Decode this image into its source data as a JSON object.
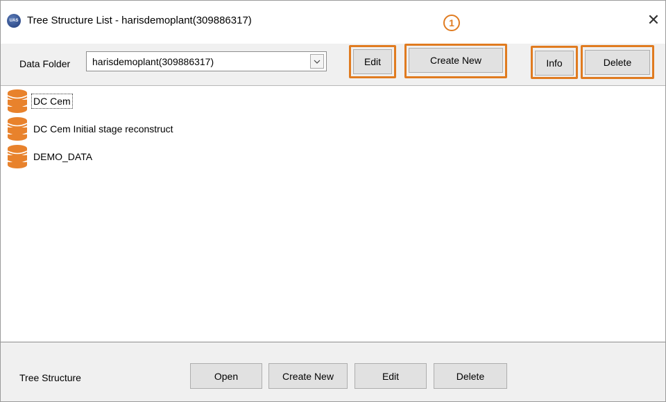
{
  "window": {
    "title": "Tree Structure List - harisdemoplant(309886317)",
    "logo_text": "UAS",
    "close_glyph": "✕"
  },
  "annotation": {
    "step": "1",
    "color": "#e07b20"
  },
  "toolbar": {
    "data_folder_label": "Data Folder",
    "data_folder_value": "harisdemoplant(309886317)",
    "edit_label": "Edit",
    "create_new_label": "Create New",
    "info_label": "Info",
    "delete_label": "Delete"
  },
  "tree_list": {
    "items": [
      {
        "label": "DC Cem",
        "icon": "database-icon"
      },
      {
        "label": "DC Cem Initial stage reconstruct",
        "icon": "database-icon"
      },
      {
        "label": "DEMO_DATA",
        "icon": "database-icon"
      }
    ],
    "icon_color": "#e8822c"
  },
  "bottom_bar": {
    "label": "Tree Structure",
    "open_label": "Open",
    "create_new_label": "Create New",
    "edit_label": "Edit",
    "delete_label": "Delete"
  }
}
